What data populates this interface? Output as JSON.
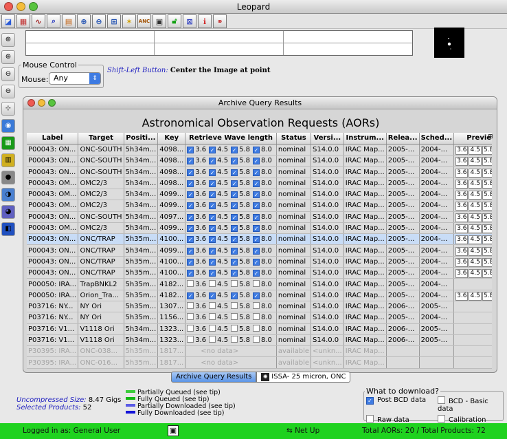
{
  "window": {
    "title": "Leopard"
  },
  "toolbar": {
    "buttons": [
      "open-icon",
      "image-icon",
      "plot-icon",
      "search-icon",
      "grid-icon",
      "zoom-icon",
      "zoom-out-icon",
      "zoom-in-icon",
      "star-icon",
      "ANC",
      "save-icon",
      "lock-icon",
      "close-box-icon",
      "info-icon",
      "link-icon"
    ],
    "anc_label": "ANC"
  },
  "mouse_control": {
    "legend": "Mouse Control",
    "label": "Mouse:",
    "value": "Any",
    "hint_prefix": "Shift-Left Button:",
    "hint_text": "Center the Image at point"
  },
  "aor_window": {
    "title": "Archive Query Results",
    "heading": "Astronomical Observation Requests (AORs)"
  },
  "table": {
    "columns": [
      "Label",
      "Target",
      "Positi...",
      "Key",
      "Retrieve Wave length",
      "Status",
      "Versi...",
      "Instrum...",
      "Relea...",
      "Sched...",
      "Preview"
    ],
    "wave_labels": [
      "3.6",
      "4.5",
      "5.8",
      "8.0"
    ],
    "preview_labels": [
      "3.6",
      "4.5",
      "5.8",
      "8.0"
    ],
    "rows": [
      {
        "label": "P00043: ON...",
        "target": "ONC-SOUTH",
        "pos": "5h34m...",
        "key": "4098...",
        "checked": true,
        "status": "nominal",
        "version": "S14.0.0",
        "instrument": "IRAC Map...",
        "release": "2005-...",
        "sched": "2004-...",
        "preview": true,
        "style": "norm"
      },
      {
        "label": "P00043: ON...",
        "target": "ONC-SOUTH",
        "pos": "5h34m...",
        "key": "4098...",
        "checked": true,
        "status": "nominal",
        "version": "S14.0.0",
        "instrument": "IRAC Map...",
        "release": "2005-...",
        "sched": "2004-...",
        "preview": true,
        "style": "norm"
      },
      {
        "label": "P00043: ON...",
        "target": "ONC-SOUTH",
        "pos": "5h34m...",
        "key": "4098...",
        "checked": true,
        "status": "nominal",
        "version": "S14.0.0",
        "instrument": "IRAC Map...",
        "release": "2005-...",
        "sched": "2004-...",
        "preview": true,
        "style": "norm"
      },
      {
        "label": "P00043: OM...",
        "target": "OMC2/3",
        "pos": "5h34m...",
        "key": "4098...",
        "checked": true,
        "status": "nominal",
        "version": "S14.0.0",
        "instrument": "IRAC Map...",
        "release": "2005-...",
        "sched": "2004-...",
        "preview": true,
        "style": "norm"
      },
      {
        "label": "P00043: OM...",
        "target": "OMC2/3",
        "pos": "5h34m...",
        "key": "4099...",
        "checked": true,
        "status": "nominal",
        "version": "S14.0.0",
        "instrument": "IRAC Map...",
        "release": "2005-...",
        "sched": "2004-...",
        "preview": true,
        "style": "norm"
      },
      {
        "label": "P00043: OM...",
        "target": "OMC2/3",
        "pos": "5h34m...",
        "key": "4099...",
        "checked": true,
        "status": "nominal",
        "version": "S14.0.0",
        "instrument": "IRAC Map...",
        "release": "2005-...",
        "sched": "2004-...",
        "preview": true,
        "style": "norm"
      },
      {
        "label": "P00043: ON...",
        "target": "ONC-SOUTH",
        "pos": "5h34m...",
        "key": "4097...",
        "checked": true,
        "status": "nominal",
        "version": "S14.0.0",
        "instrument": "IRAC Map...",
        "release": "2005-...",
        "sched": "2004-...",
        "preview": true,
        "style": "norm"
      },
      {
        "label": "P00043: OM...",
        "target": "OMC2/3",
        "pos": "5h34m...",
        "key": "4099...",
        "checked": true,
        "status": "nominal",
        "version": "S14.0.0",
        "instrument": "IRAC Map...",
        "release": "2005-...",
        "sched": "2004-...",
        "preview": true,
        "style": "norm"
      },
      {
        "label": "P00043: ON...",
        "target": "ONC/TRAP",
        "pos": "5h35m...",
        "key": "4100...",
        "checked": true,
        "status": "nominal",
        "version": "S14.0.0",
        "instrument": "IRAC Map...",
        "release": "2005-...",
        "sched": "2004-...",
        "preview": true,
        "style": "sel"
      },
      {
        "label": "P00043: ON...",
        "target": "ONC/TRAP",
        "pos": "5h34m...",
        "key": "4099...",
        "checked": true,
        "status": "nominal",
        "version": "S14.0.0",
        "instrument": "IRAC Map...",
        "release": "2005-...",
        "sched": "2004-...",
        "preview": true,
        "style": "norm"
      },
      {
        "label": "P00043: ON...",
        "target": "ONC/TRAP",
        "pos": "5h35m...",
        "key": "4100...",
        "checked": true,
        "status": "nominal",
        "version": "S14.0.0",
        "instrument": "IRAC Map...",
        "release": "2005-...",
        "sched": "2004-...",
        "preview": true,
        "style": "norm"
      },
      {
        "label": "P00043: ON...",
        "target": "ONC/TRAP",
        "pos": "5h35m...",
        "key": "4100...",
        "checked": true,
        "status": "nominal",
        "version": "S14.0.0",
        "instrument": "IRAC Map...",
        "release": "2005-...",
        "sched": "2004-...",
        "preview": true,
        "style": "norm"
      },
      {
        "label": "P00050: IRA...",
        "target": "TrapBNKL2",
        "pos": "5h35m...",
        "key": "4182...",
        "checked": false,
        "status": "nominal",
        "version": "S14.0.0",
        "instrument": "IRAC Map...",
        "release": "2005-...",
        "sched": "2004-...",
        "preview": false,
        "style": "norm"
      },
      {
        "label": "P00050: IRA...",
        "target": "Orion_Tra...",
        "pos": "5h35m...",
        "key": "4182...",
        "checked": true,
        "status": "nominal",
        "version": "S14.0.0",
        "instrument": "IRAC Map...",
        "release": "2005-...",
        "sched": "2004-...",
        "preview": true,
        "style": "norm"
      },
      {
        "label": "P03716: NY...",
        "target": "NY Ori",
        "pos": "5h35m...",
        "key": "1307...",
        "checked": false,
        "status": "nominal",
        "version": "S14.0.0",
        "instrument": "IRAC Map...",
        "release": "2006-...",
        "sched": "2005-...",
        "preview": false,
        "style": "norm"
      },
      {
        "label": "P03716: NY...",
        "target": "NY Ori",
        "pos": "5h35m...",
        "key": "1156...",
        "checked": false,
        "status": "nominal",
        "version": "S14.0.0",
        "instrument": "IRAC Map...",
        "release": "2005-...",
        "sched": "2004-...",
        "preview": false,
        "style": "norm"
      },
      {
        "label": "P03716: V1...",
        "target": "V1118 Ori",
        "pos": "5h34m...",
        "key": "1323...",
        "checked": false,
        "status": "nominal",
        "version": "S14.0.0",
        "instrument": "IRAC Map...",
        "release": "2006-...",
        "sched": "2005-...",
        "preview": false,
        "style": "norm"
      },
      {
        "label": "P03716: V1...",
        "target": "V1118 Ori",
        "pos": "5h34m...",
        "key": "1323...",
        "checked": false,
        "status": "nominal",
        "version": "S14.0.0",
        "instrument": "IRAC Map...",
        "release": "2006-...",
        "sched": "2005-...",
        "preview": false,
        "style": "norm"
      },
      {
        "label": "P30395: IRA...",
        "target": "ONC-038...",
        "pos": "5h35m...",
        "key": "1817...",
        "checked": null,
        "nodata": "<no data>",
        "status": "available",
        "version": "<unkn...",
        "instrument": "IRAC Map...",
        "release": "",
        "sched": "",
        "preview": false,
        "style": "grey"
      },
      {
        "label": "P30395: IRA...",
        "target": "ONC-016...",
        "pos": "5h35m...",
        "key": "1817...",
        "checked": null,
        "nodata": "<no data>",
        "status": "available",
        "version": "<unkn...",
        "instrument": "IRAC Map...",
        "release": "",
        "sched": "",
        "preview": false,
        "style": "grey"
      }
    ]
  },
  "tabs": {
    "active": "Archive Query Results",
    "other": "ISSA- 25 micron,  ONC"
  },
  "info": {
    "size_label": "Uncompressed Size:",
    "size_value": "8.47 Gigs",
    "products_label": "Selected Products:",
    "products_value": "52"
  },
  "legend_items": [
    {
      "label": "Partially Queued (see tip)",
      "color": "#3ccc3c"
    },
    {
      "label": "Fully Queued (see tip)",
      "color": "#14b814"
    },
    {
      "label": "Partially Downloaded (see tip)",
      "color": "#5a5ae6"
    },
    {
      "label": "Fully Downloaded (see tip)",
      "color": "#1414d8"
    }
  ],
  "download": {
    "legend": "What to download?",
    "options": [
      {
        "label": "Post BCD data",
        "checked": true
      },
      {
        "label": "BCD - Basic data",
        "checked": false
      },
      {
        "label": "Raw data",
        "checked": false
      },
      {
        "label": "Calibration data",
        "checked": false
      }
    ]
  },
  "status": {
    "logged_in": "Logged in as:  General User",
    "net": "Net Up",
    "totals": "Total AORs: 20  / Total Products: 72"
  },
  "colors": {
    "status_bar": "#1fd21f",
    "selected_row": "#c8dcf6",
    "checkbox": "#3e7be2"
  }
}
